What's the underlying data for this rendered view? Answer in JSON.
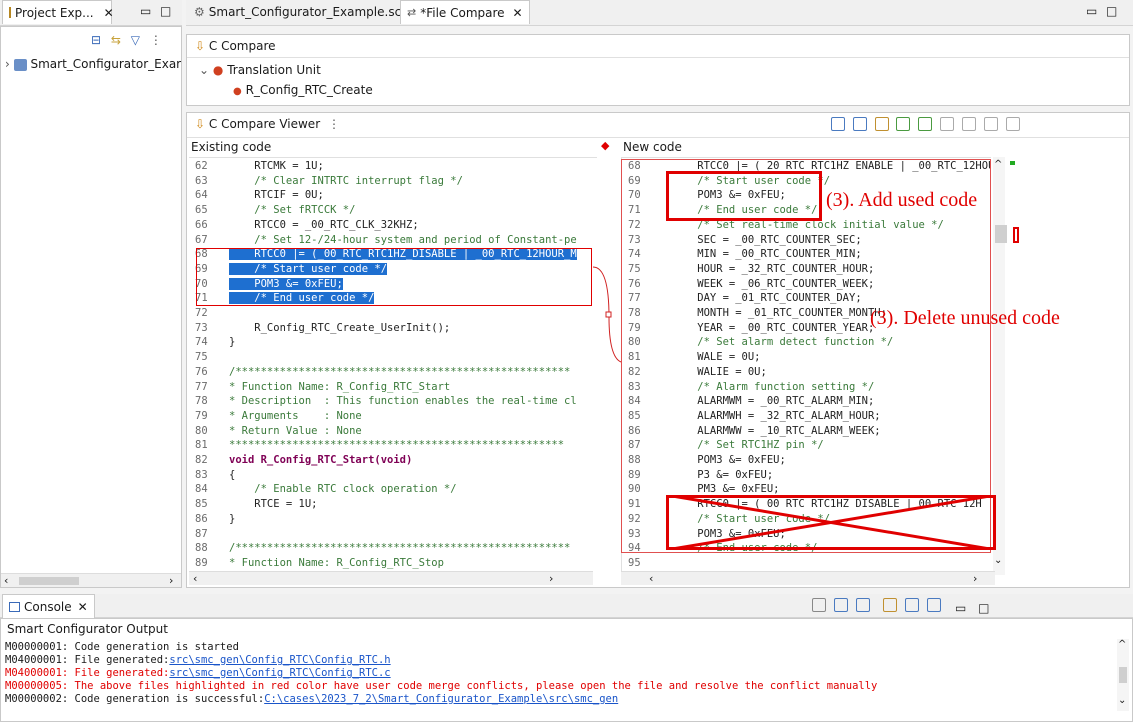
{
  "left_panel": {
    "tab_label": "Project Exp...",
    "tree_item": "Smart_Configurator_Exar"
  },
  "editor": {
    "tabs": [
      {
        "label": "Smart_Configurator_Example.scfg"
      },
      {
        "label": "*File Compare"
      }
    ],
    "c_compare_label": "C Compare",
    "tree": {
      "translation_unit": "Translation Unit",
      "function": "R_Config_RTC_Create"
    },
    "viewer_label": "C Compare Viewer",
    "existing_header": "Existing code",
    "new_header": "New code"
  },
  "existing_code": [
    {
      "n": "62",
      "t": "    RTCMK = 1U;"
    },
    {
      "n": "63",
      "t": "    /* Clear INTRTC interrupt flag */"
    },
    {
      "n": "64",
      "t": "    RTCIF = 0U;"
    },
    {
      "n": "65",
      "t": "    /* Set fRTCCK */"
    },
    {
      "n": "66",
      "t": "    RTCC0 = _00_RTC_CLK_32KHZ;"
    },
    {
      "n": "67",
      "t": "    /* Set 12-/24-hour system and period of Constant-pe"
    },
    {
      "n": "68",
      "t": "    RTCC0 |= (_00_RTC_RTC1HZ_DISABLE | _00_RTC_12HOUR_M"
    },
    {
      "n": "69",
      "t": "    /* Start user code */"
    },
    {
      "n": "70",
      "t": "    POM3 &= 0xFEU;"
    },
    {
      "n": "71",
      "t": "    /* End user code */"
    },
    {
      "n": "72",
      "t": ""
    },
    {
      "n": "73",
      "t": "    R_Config_RTC_Create_UserInit();"
    },
    {
      "n": "74",
      "t": "}"
    },
    {
      "n": "75",
      "t": ""
    },
    {
      "n": "76",
      "t": "/*****************************************************"
    },
    {
      "n": "77",
      "t": "* Function Name: R_Config_RTC_Start"
    },
    {
      "n": "78",
      "t": "* Description  : This function enables the real-time cl"
    },
    {
      "n": "79",
      "t": "* Arguments    : None"
    },
    {
      "n": "80",
      "t": "* Return Value : None"
    },
    {
      "n": "81",
      "t": "*****************************************************"
    },
    {
      "n": "82",
      "t": "void R_Config_RTC_Start(void)"
    },
    {
      "n": "83",
      "t": "{"
    },
    {
      "n": "84",
      "t": "    /* Enable RTC clock operation */"
    },
    {
      "n": "85",
      "t": "    RTCE = 1U;"
    },
    {
      "n": "86",
      "t": "}"
    },
    {
      "n": "87",
      "t": ""
    },
    {
      "n": "88",
      "t": "/*****************************************************"
    },
    {
      "n": "89",
      "t": "* Function Name: R_Config_RTC_Stop"
    }
  ],
  "new_code": [
    {
      "n": "68",
      "t": "    RTCC0 |= ( 20 RTC RTC1HZ ENABLE | _00_RTC_12HOU"
    },
    {
      "n": "69",
      "t": "    /* Start user code */"
    },
    {
      "n": "70",
      "t": "    POM3 &= 0xFEU;"
    },
    {
      "n": "71",
      "t": "    /* End user code */"
    },
    {
      "n": "72",
      "t": "    /* Set real-time clock initial value */"
    },
    {
      "n": "73",
      "t": "    SEC = _00_RTC_COUNTER_SEC;"
    },
    {
      "n": "74",
      "t": "    MIN = _00_RTC_COUNTER_MIN;"
    },
    {
      "n": "75",
      "t": "    HOUR = _32_RTC_COUNTER_HOUR;"
    },
    {
      "n": "76",
      "t": "    WEEK = _06_RTC_COUNTER_WEEK;"
    },
    {
      "n": "77",
      "t": "    DAY = _01_RTC_COUNTER_DAY;"
    },
    {
      "n": "78",
      "t": "    MONTH = _01_RTC_COUNTER_MONTH;"
    },
    {
      "n": "79",
      "t": "    YEAR = _00_RTC_COUNTER_YEAR;"
    },
    {
      "n": "80",
      "t": "    /* Set alarm detect function */"
    },
    {
      "n": "81",
      "t": "    WALE = 0U;"
    },
    {
      "n": "82",
      "t": "    WALIE = 0U;"
    },
    {
      "n": "83",
      "t": "    /* Alarm function setting */"
    },
    {
      "n": "84",
      "t": "    ALARMWM = _00_RTC_ALARM_MIN;"
    },
    {
      "n": "85",
      "t": "    ALARMWH = _32_RTC_ALARM_HOUR;"
    },
    {
      "n": "86",
      "t": "    ALARMWW = _10_RTC_ALARM_WEEK;"
    },
    {
      "n": "87",
      "t": "    /* Set RTC1HZ pin */"
    },
    {
      "n": "88",
      "t": "    POM3 &= 0xFEU;"
    },
    {
      "n": "89",
      "t": "    P3 &= 0xFEU;"
    },
    {
      "n": "90",
      "t": "    PM3 &= 0xFEU;"
    },
    {
      "n": "91",
      "t": "    RTCC0 |= ( 00 RTC RTC1HZ DISABLE | 00 RTC 12H"
    },
    {
      "n": "92",
      "t": "    /* Start user code */"
    },
    {
      "n": "93",
      "t": "    POM3 &= 0xFEU;"
    },
    {
      "n": "94",
      "t": "    /* End user code */"
    },
    {
      "n": "95",
      "t": ""
    }
  ],
  "annotations": {
    "add": "(3). Add used code",
    "delete": "(3). Delete unused code"
  },
  "console": {
    "tab_label": "Console",
    "title": "Smart Configurator Output",
    "lines": [
      {
        "text": "M00000001: Code generation is started",
        "link": "",
        "color": "black"
      },
      {
        "text": "M04000001: File generated:",
        "link": "src\\smc_gen\\Config_RTC\\Config_RTC.h",
        "color": "black"
      },
      {
        "text": "M04000001: File generated:",
        "link": "src\\smc_gen\\Config_RTC\\Config_RTC.c",
        "color": "red"
      },
      {
        "text": "M00000005: The above files highlighted in red color have user code merge conflicts, please open the file and resolve the conflict manually",
        "link": "",
        "color": "red"
      },
      {
        "text": "M00000002: Code generation is successful:",
        "link": "C:\\cases\\2023_7_2\\Smart_Configurator_Example\\src\\smc_gen",
        "color": "black"
      }
    ]
  },
  "colors": {
    "annotation_red": "#e00000",
    "selection_blue": "#1e6fd0"
  }
}
